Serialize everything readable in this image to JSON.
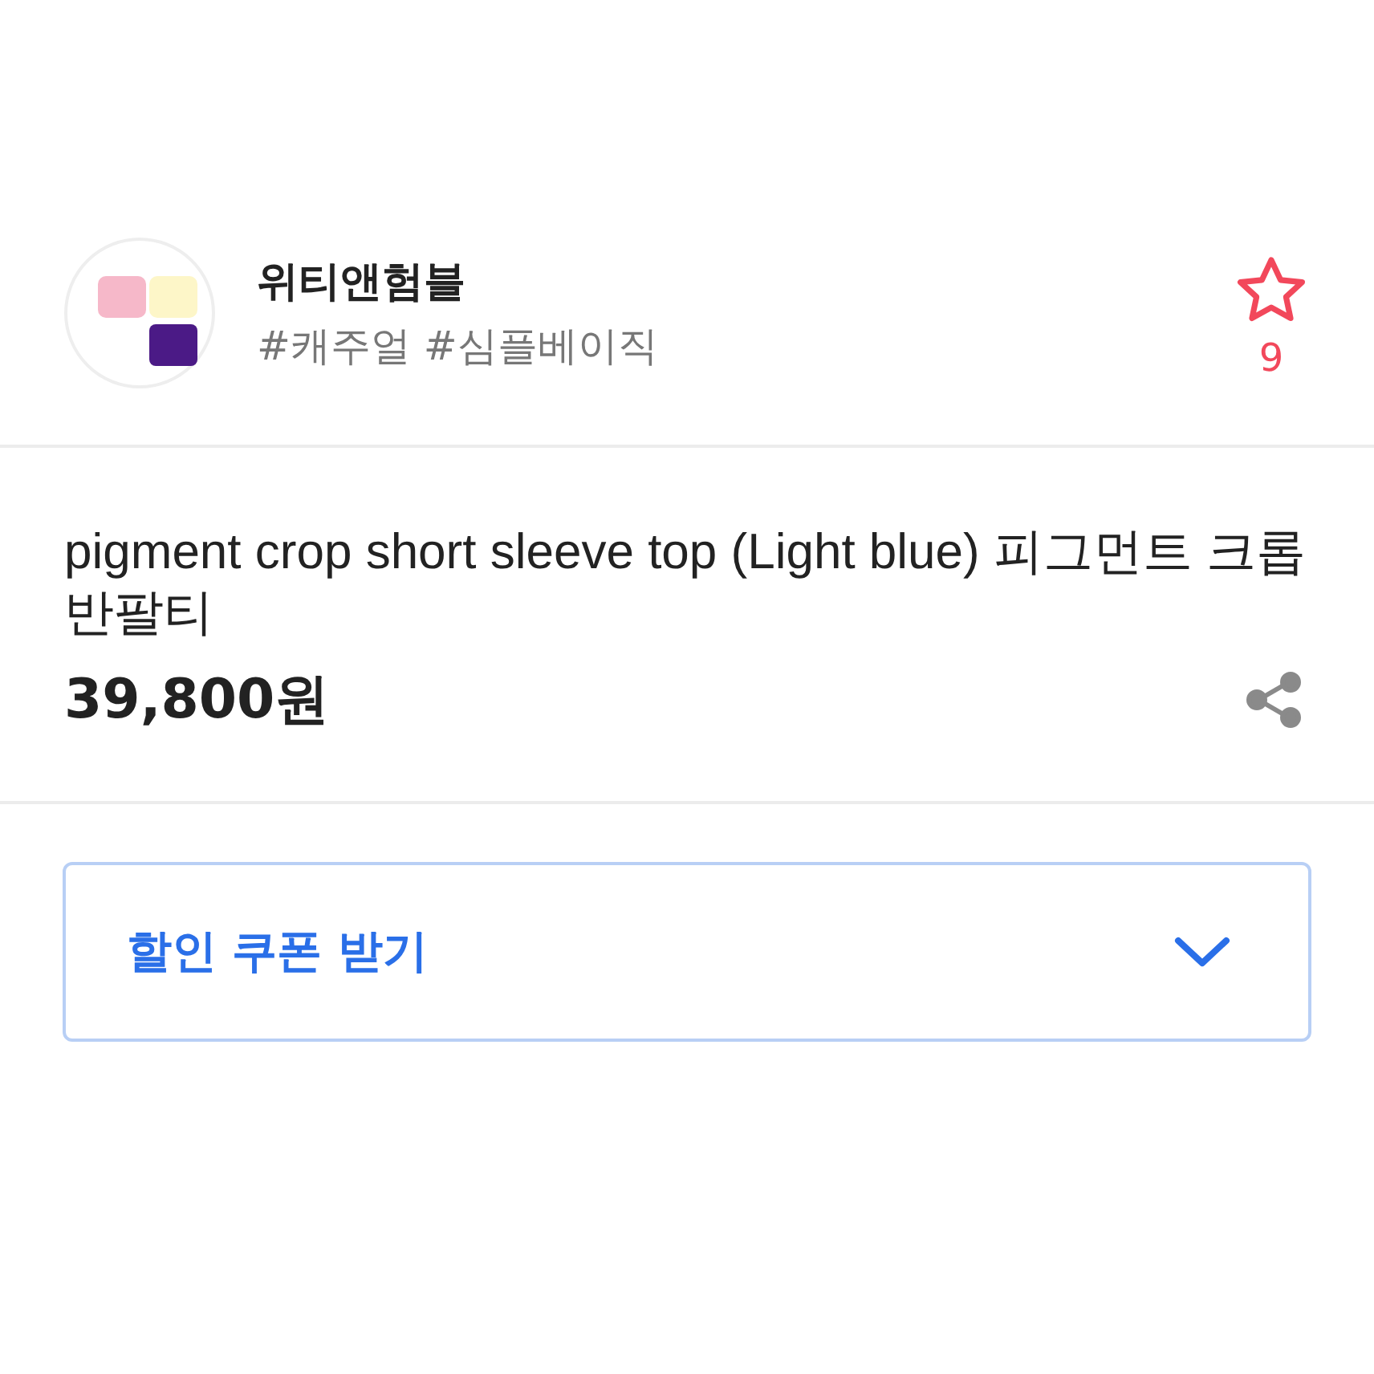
{
  "store": {
    "name": "위티앤험블",
    "tags": "#캐주얼 #심플베이직",
    "favorited": false,
    "favorite_count": "9"
  },
  "product": {
    "title": "pigment crop short sleeve top (Light blue) 피그먼트 크롭 반팔티",
    "price": "39,800원"
  },
  "coupon": {
    "label": "할인 쿠폰 받기",
    "expanded": false
  }
}
